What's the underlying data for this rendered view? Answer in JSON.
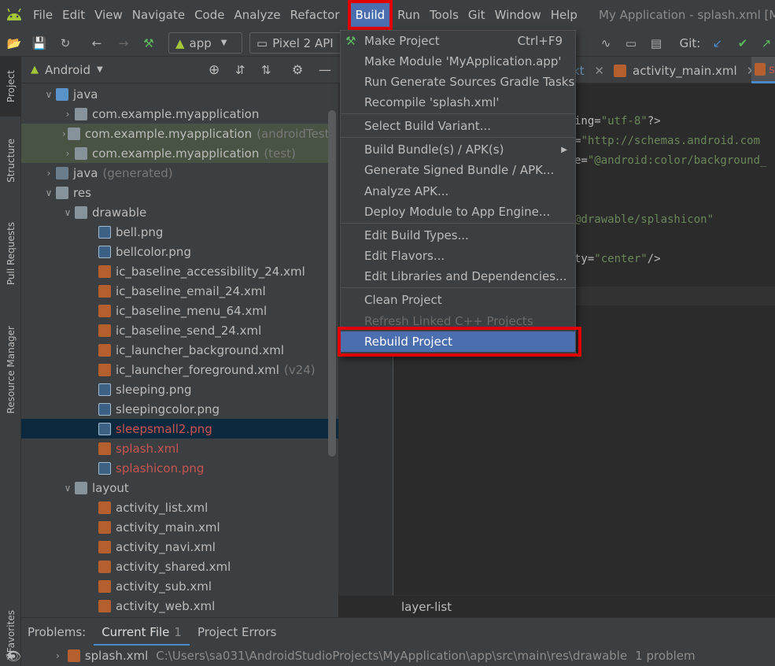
{
  "menubar": {
    "items": [
      "File",
      "Edit",
      "View",
      "Navigate",
      "Code",
      "Analyze",
      "Refactor",
      "Build",
      "Run",
      "Tools",
      "Git",
      "Window",
      "Help"
    ],
    "window_title": "My Application - splash.xml [My_"
  },
  "toolbar": {
    "config": "app",
    "device": "Pixel 2 API",
    "git_label": "Git:"
  },
  "side_tabs": {
    "project": "Project",
    "structure": "Structure",
    "pull_requests": "Pull Requests",
    "resource_manager": "Resource Manager",
    "favorites": "Favorites"
  },
  "project_panel": {
    "view": "Android",
    "rows": [
      {
        "label": "java",
        "secondary": ""
      },
      {
        "label": "com.example.myapplication",
        "secondary": ""
      },
      {
        "label": "com.example.myapplication",
        "secondary": "(androidTest)"
      },
      {
        "label": "com.example.myapplication",
        "secondary": "(test)"
      },
      {
        "label": "java",
        "secondary": "(generated)"
      },
      {
        "label": "res",
        "secondary": ""
      },
      {
        "label": "drawable",
        "secondary": ""
      },
      {
        "label": "bell.png",
        "secondary": ""
      },
      {
        "label": "bellcolor.png",
        "secondary": ""
      },
      {
        "label": "ic_baseline_accessibility_24.xml",
        "secondary": ""
      },
      {
        "label": "ic_baseline_email_24.xml",
        "secondary": ""
      },
      {
        "label": "ic_baseline_menu_64.xml",
        "secondary": ""
      },
      {
        "label": "ic_baseline_send_24.xml",
        "secondary": ""
      },
      {
        "label": "ic_launcher_background.xml",
        "secondary": ""
      },
      {
        "label": "ic_launcher_foreground.xml",
        "secondary": "(v24)"
      },
      {
        "label": "sleeping.png",
        "secondary": ""
      },
      {
        "label": "sleepingcolor.png",
        "secondary": ""
      },
      {
        "label": "sleepsmall2.png",
        "secondary": ""
      },
      {
        "label": "splash.xml",
        "secondary": ""
      },
      {
        "label": "splashicon.png",
        "secondary": ""
      },
      {
        "label": "layout",
        "secondary": ""
      },
      {
        "label": "activity_list.xml",
        "secondary": ""
      },
      {
        "label": "activity_main.xml",
        "secondary": ""
      },
      {
        "label": "activity_navi.xml",
        "secondary": ""
      },
      {
        "label": "activity_shared.xml",
        "secondary": ""
      },
      {
        "label": "activity_sub.xml",
        "secondary": ""
      },
      {
        "label": "activity_web.xml",
        "secondary": ""
      }
    ]
  },
  "editor": {
    "tab_partial": "kt",
    "tab_main": "activity_main.xml",
    "tab_splash_partial": "s",
    "code": {
      "l1_attr": "ing=",
      "l1_val": "\"utf-8\"",
      "l1_end": "?>",
      "l2_attr": "=",
      "l2_val": "\"http://schemas.android.com",
      "l3_attr": "e=",
      "l3_val": "\"@android:color/background_",
      "l4_val": "@drawable/splashicon\"",
      "l5_attr": "ty=",
      "l5_val": "\"center\"",
      "l5_end": "/>"
    },
    "breadcrumb": "layer-list"
  },
  "build_menu": {
    "items": [
      {
        "label": "Make Project",
        "shortcut": "Ctrl+F9"
      },
      {
        "label": "Make Module 'MyApplication.app'"
      },
      {
        "label": "Run Generate Sources Gradle Tasks"
      },
      {
        "label": "Recompile 'splash.xml'"
      },
      {
        "label": "Select Build Variant..."
      },
      {
        "label": "Build Bundle(s) / APK(s)"
      },
      {
        "label": "Generate Signed Bundle / APK..."
      },
      {
        "label": "Analyze APK..."
      },
      {
        "label": "Deploy Module to App Engine..."
      },
      {
        "label": "Edit Build Types..."
      },
      {
        "label": "Edit Flavors..."
      },
      {
        "label": "Edit Libraries and Dependencies..."
      },
      {
        "label": "Clean Project"
      },
      {
        "label": "Refresh Linked C++ Projects"
      },
      {
        "label": "Rebuild Project"
      }
    ]
  },
  "problems": {
    "label": "Problems:",
    "tabs": [
      {
        "label": "Current File",
        "count": "1"
      },
      {
        "label": "Project Errors"
      }
    ],
    "file": "splash.xml",
    "path": "C:\\Users\\sa031\\AndroidStudioProjects\\MyApplication\\app\\src\\main\\res\\drawable",
    "summary": "1 problem"
  },
  "colors": {
    "highlight": "#4b6eaf",
    "annotation": "#e00000",
    "background": "#3c3f41"
  }
}
